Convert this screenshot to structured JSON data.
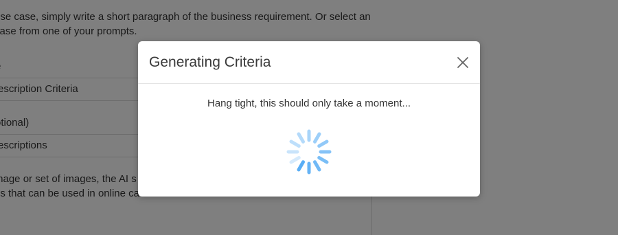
{
  "background": {
    "intro_line1": "use case, simply write a short paragraph of the business requirement. Or select an",
    "intro_line2": "case from one of your prompts.",
    "label1": "e",
    "field1_value": "escription Criteria",
    "label2": "otional)",
    "field2_value": "escriptions",
    "desc_line1": "mage or set of images, the AI s",
    "desc_line2": "ns that can be used in online ca"
  },
  "modal": {
    "title": "Generating Criteria",
    "message": "Hang tight, this should only take a moment...",
    "spinner_color": "#5aaef5"
  },
  "colors": {
    "overlay": "rgba(0,0,0,0.5)",
    "modal_bg": "#ffffff"
  }
}
